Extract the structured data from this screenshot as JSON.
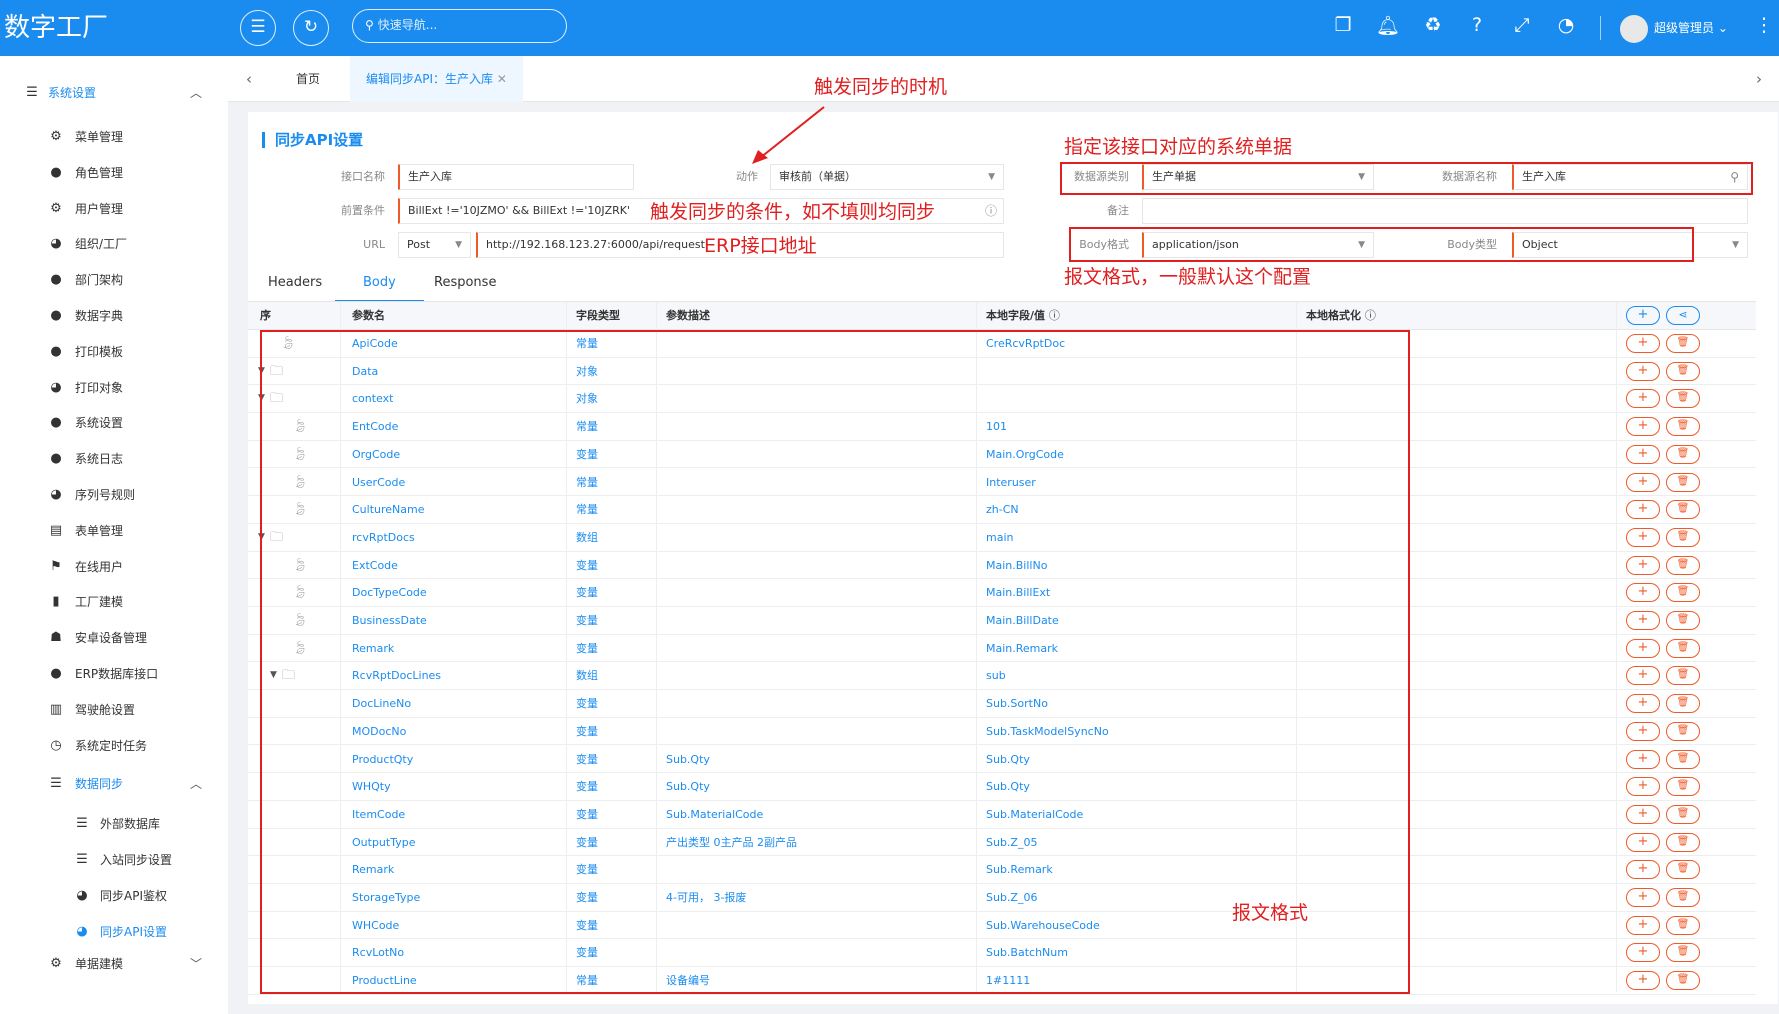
{
  "app": {
    "logo": "数字工厂",
    "search_placeholder": "快速导航...",
    "user": "超级管理员"
  },
  "sidebar": {
    "group_system": "系统设置",
    "items": [
      "菜单管理",
      "角色管理",
      "用户管理",
      "组织/工厂",
      "部门架构",
      "数据字典",
      "打印模板",
      "打印对象",
      "系统设置",
      "系统日志",
      "序列号规则",
      "表单管理",
      "在线用户",
      "工厂建模",
      "安卓设备管理",
      "ERP数据库接口",
      "驾驶舱设置",
      "系统定时任务"
    ],
    "group_sync": "数据同步",
    "sync_items": [
      "外部数据库",
      "入站同步设置",
      "同步API鉴权",
      "同步API设置"
    ],
    "group_doc": "单据建模"
  },
  "tabs": {
    "home": "首页",
    "current": "编辑同步API：生产入库"
  },
  "form": {
    "title": "同步API设置",
    "name_label": "接口名称",
    "name_value": "生产入库",
    "action_label": "动作",
    "action_value": "审核前（单据）",
    "cond_label": "前置条件",
    "cond_value": "BillExt !='10JZMO'  &&  BillExt !='10JZRK'",
    "url_label": "URL",
    "method_value": "Post",
    "url_value": "http://192.168.123.27:6000/api/request",
    "ds_type_label": "数据源类别",
    "ds_type_value": "生产单据",
    "ds_name_label": "数据源名称",
    "ds_name_value": "生产入库",
    "remark_label": "备注",
    "body_format_label": "Body格式",
    "body_format_value": "application/json",
    "body_type_label": "Body类型",
    "body_type_value": "Object"
  },
  "annotations": {
    "trigger_time": "触发同步的时机",
    "target_doc": "指定该接口对应的系统单据",
    "trigger_cond": "触发同步的条件，如不填则均同步",
    "erp_url": "ERP接口地址",
    "body_note": "报文格式，一般默认这个配置",
    "table_note": "报文格式"
  },
  "subtabs": [
    "Headers",
    "Body",
    "Response"
  ],
  "table": {
    "headers": [
      "序",
      "参数名",
      "字段类型",
      "参数描述",
      "本地字段/值",
      "本地格式化"
    ],
    "rows": [
      {
        "name": "ApiCode",
        "type": "常量",
        "desc": "",
        "local": "CreRcvRptDoc",
        "level": 0,
        "icon": "leaf"
      },
      {
        "name": "Data",
        "type": "对象",
        "desc": "",
        "local": "",
        "level": 0,
        "icon": "folder"
      },
      {
        "name": "context",
        "type": "对象",
        "desc": "",
        "local": "",
        "level": 1,
        "icon": "folder"
      },
      {
        "name": "EntCode",
        "type": "常量",
        "desc": "",
        "local": "101",
        "level": 2,
        "icon": "leaf"
      },
      {
        "name": "OrgCode",
        "type": "变量",
        "desc": "",
        "local": "Main.OrgCode",
        "level": 2,
        "icon": "leaf"
      },
      {
        "name": "UserCode",
        "type": "常量",
        "desc": "",
        "local": "Interuser",
        "level": 2,
        "icon": "leaf"
      },
      {
        "name": "CultureName",
        "type": "常量",
        "desc": "",
        "local": "zh-CN",
        "level": 2,
        "icon": "leaf"
      },
      {
        "name": "rcvRptDocs",
        "type": "数组",
        "desc": "",
        "local": "main",
        "level": 1,
        "icon": "folder"
      },
      {
        "name": "ExtCode",
        "type": "变量",
        "desc": "",
        "local": "Main.BillNo",
        "level": 2,
        "icon": "leaf"
      },
      {
        "name": "DocTypeCode",
        "type": "变量",
        "desc": "",
        "local": "Main.BillExt",
        "level": 2,
        "icon": "leaf"
      },
      {
        "name": "BusinessDate",
        "type": "变量",
        "desc": "",
        "local": "Main.BillDate",
        "level": 2,
        "icon": "leaf"
      },
      {
        "name": "Remark",
        "type": "变量",
        "desc": "",
        "local": "Main.Remark",
        "level": 2,
        "icon": "leaf"
      },
      {
        "name": "RcvRptDocLines",
        "type": "数组",
        "desc": "",
        "local": "sub",
        "level": 2,
        "icon": "folder"
      },
      {
        "name": "DocLineNo",
        "type": "变量",
        "desc": "",
        "local": "Sub.SortNo",
        "level": 3,
        "icon": "none"
      },
      {
        "name": "MODocNo",
        "type": "变量",
        "desc": "",
        "local": "Sub.TaskModelSyncNo",
        "level": 3,
        "icon": "none"
      },
      {
        "name": "ProductQty",
        "type": "变量",
        "desc": "Sub.Qty",
        "local": "Sub.Qty",
        "level": 3,
        "icon": "none"
      },
      {
        "name": "WHQty",
        "type": "变量",
        "desc": "Sub.Qty",
        "local": "Sub.Qty",
        "level": 3,
        "icon": "none"
      },
      {
        "name": "ItemCode",
        "type": "变量",
        "desc": "Sub.MaterialCode",
        "local": "Sub.MaterialCode",
        "level": 3,
        "icon": "none"
      },
      {
        "name": "OutputType",
        "type": "变量",
        "desc": "产出类型 0主产品 2副产品",
        "local": "Sub.Z_05",
        "level": 3,
        "icon": "none"
      },
      {
        "name": "Remark",
        "type": "变量",
        "desc": "",
        "local": "Sub.Remark",
        "level": 3,
        "icon": "none"
      },
      {
        "name": "StorageType",
        "type": "变量",
        "desc": "4-可用， 3-报废",
        "local": "Sub.Z_06",
        "level": 3,
        "icon": "none"
      },
      {
        "name": "WHCode",
        "type": "变量",
        "desc": "",
        "local": "Sub.WarehouseCode",
        "level": 3,
        "icon": "none"
      },
      {
        "name": "RcvLotNo",
        "type": "变量",
        "desc": "",
        "local": "Sub.BatchNum",
        "level": 3,
        "icon": "none"
      },
      {
        "name": "ProductLine",
        "type": "常量",
        "desc": "设备编号",
        "local": "1#1111",
        "level": 3,
        "icon": "none"
      }
    ]
  },
  "colors": {
    "primary": "#1a8cf0",
    "annotation": "#e02020",
    "action": "#f05a28"
  }
}
